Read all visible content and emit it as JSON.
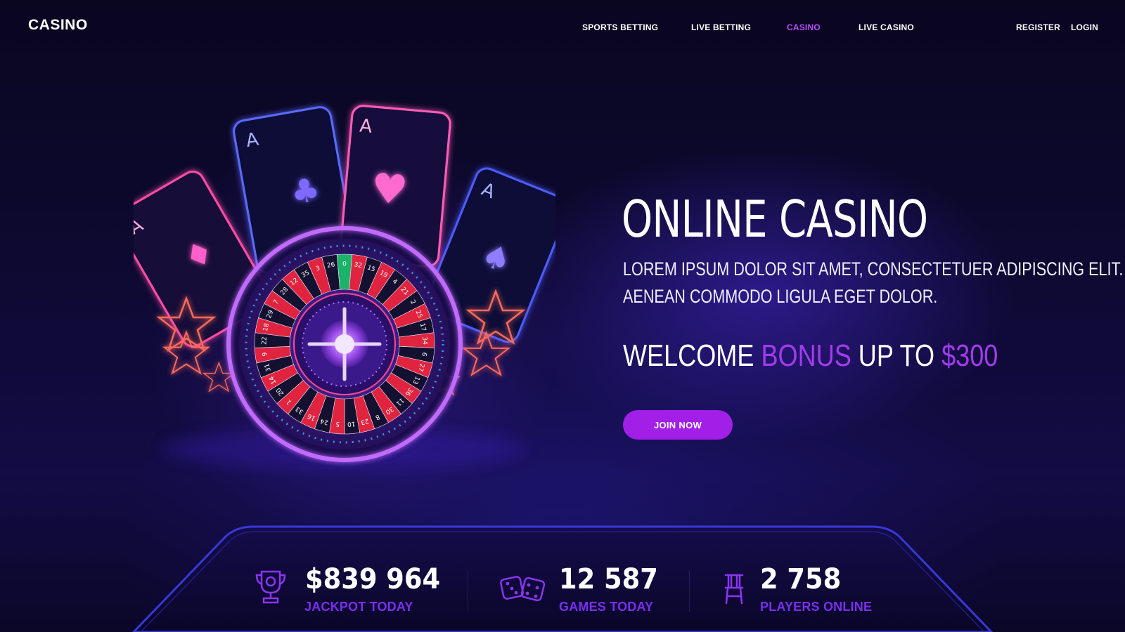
{
  "brand": {
    "logo": "CASINO"
  },
  "nav": {
    "items": [
      {
        "label": "SPORTS BETTING",
        "active": false
      },
      {
        "label": "LIVE BETTING",
        "active": false
      },
      {
        "label": "CASINO",
        "active": true
      },
      {
        "label": "LIVE CASINO",
        "active": false
      }
    ],
    "register": "REGISTER",
    "login": "LOGIN"
  },
  "hero": {
    "title": "ONLINE CASINO",
    "subtitle_line1": "LOREM IPSUM DOLOR SIT AMET, CONSECTETUER ADIPISCING ELIT.",
    "subtitle_line2": "AENEAN COMMODO LIGULA EGET DOLOR.",
    "bonus_part1": "WELCOME ",
    "bonus_highlight1": "BONUS",
    "bonus_part2": " UP TO ",
    "bonus_highlight2": "$300",
    "cta": "JOIN NOW",
    "wheel_numbers": [
      "0",
      "32",
      "15",
      "19",
      "4",
      "21",
      "2",
      "25",
      "17",
      "34",
      "6",
      "27",
      "13",
      "36",
      "11",
      "30",
      "8",
      "23",
      "10",
      "5",
      "24",
      "16",
      "33",
      "1",
      "20",
      "14",
      "31",
      "9",
      "22",
      "18",
      "29",
      "7",
      "28",
      "12",
      "35",
      "3",
      "26"
    ],
    "card_rank": "A"
  },
  "stats": [
    {
      "icon": "trophy-icon",
      "value": "$839 964",
      "label": "JACKPOT TODAY"
    },
    {
      "icon": "dice-icon",
      "value": "12 587",
      "label": "GAMES TODAY"
    },
    {
      "icon": "chair-icon",
      "value": "2 758",
      "label": "PLAYERS ONLINE"
    }
  ],
  "colors": {
    "accent": "#a21fe8",
    "highlight": "#a33bea",
    "stat_label": "#7a2ef0",
    "background": "#0d0930"
  }
}
